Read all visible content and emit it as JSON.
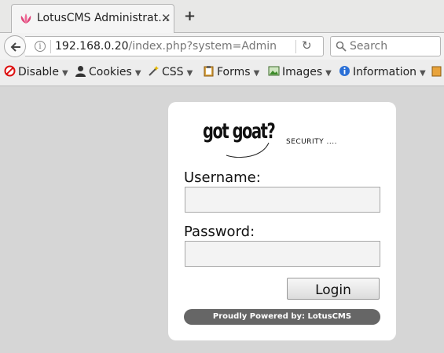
{
  "browser": {
    "tab_title": "LotusCMS Administrat…",
    "url_host": "192.168.0.20",
    "url_path": "/index.php?system=Admin",
    "search_placeholder": "Search"
  },
  "devbar": {
    "items": [
      {
        "label": "Disable",
        "icon": "disable-icon"
      },
      {
        "label": "Cookies",
        "icon": "cookies-icon"
      },
      {
        "label": "CSS",
        "icon": "css-wand-icon"
      },
      {
        "label": "Forms",
        "icon": "forms-clipboard-icon"
      },
      {
        "label": "Images",
        "icon": "images-icon"
      },
      {
        "label": "Information",
        "icon": "information-icon"
      }
    ]
  },
  "login": {
    "logo_text": "got goat?",
    "security_text": "SECURITY ....",
    "username_label": "Username:",
    "password_label": "Password:",
    "username_value": "",
    "password_value": "",
    "login_button": "Login",
    "powered_by": "Proudly Powered by: LotusCMS"
  },
  "colors": {
    "page_background": "#d6d6d6",
    "card_background": "#ffffff",
    "powered_bar": "#666666"
  }
}
